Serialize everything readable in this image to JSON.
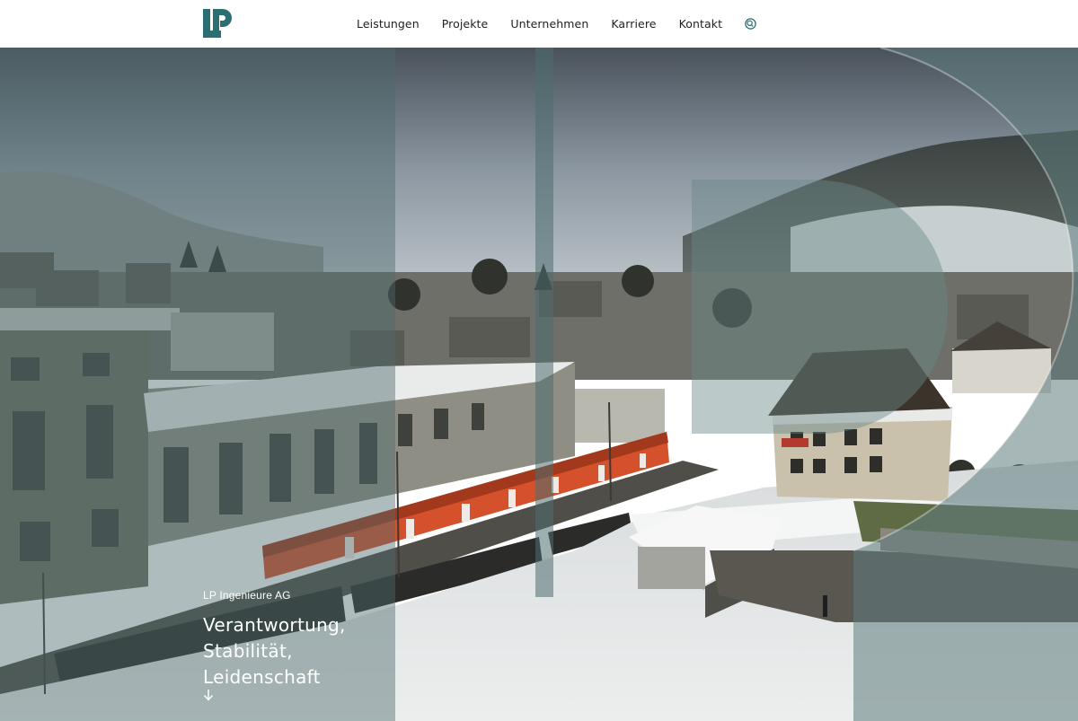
{
  "header": {
    "logo_icon": "lp-logo-icon",
    "logo_color": "#2b6f72",
    "nav": [
      {
        "label": "Leistungen"
      },
      {
        "label": "Projekte"
      },
      {
        "label": "Unternehmen"
      },
      {
        "label": "Karriere"
      },
      {
        "label": "Kontakt"
      }
    ],
    "search_icon": "search-icon",
    "accent_color": "#2b6f72"
  },
  "hero": {
    "company": "LP Ingenieure AG",
    "tagline": [
      "Verantwortung,",
      "Stabilität,",
      "Leidenschaft"
    ],
    "scroll_icon": "arrow-down-icon",
    "overlay_color": "#5b7a7a"
  }
}
